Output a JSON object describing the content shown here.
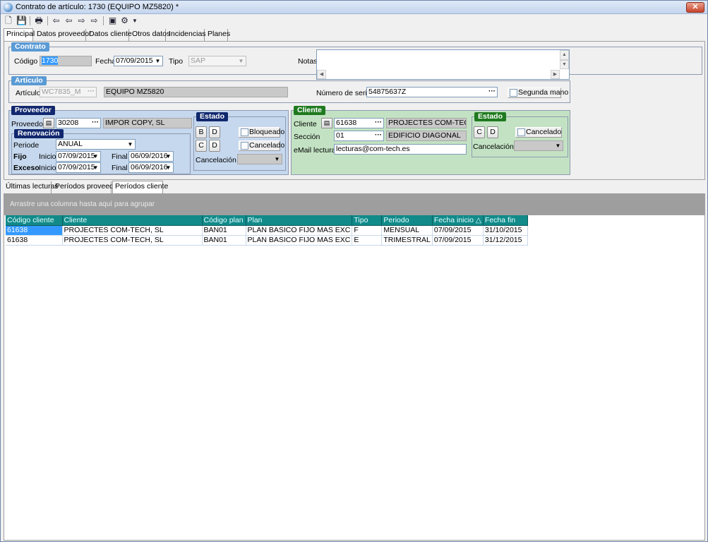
{
  "window": {
    "title": "Contrato de artículo: 1730 (EQUIPO MZ5820) *",
    "close_label": "✕"
  },
  "toolbar": {
    "icons": [
      "new-icon",
      "save-icon",
      "print-icon",
      "first-icon",
      "prev-icon",
      "next-icon",
      "last-icon",
      "export-icon",
      "tools-icon",
      "dropdown-arrow-icon"
    ]
  },
  "main_tabs": [
    "Principal",
    "Datos proveedor",
    "Datos cliente",
    "Otros datos",
    "Incidencias",
    "Planes"
  ],
  "contrato": {
    "title": "Contrato",
    "codigo_label": "Código",
    "codigo": "1730",
    "fecha_label": "Fecha",
    "fecha": "07/09/2015",
    "tipo_label": "Tipo",
    "tipo": "SAP",
    "notas_label": "Notas"
  },
  "articulo": {
    "title": "Artículo",
    "articulo_label": "Artículo",
    "articulo_code": "WC7835_M",
    "articulo_name": "EQUIPO MZ5820",
    "serie_label": "Número de serie",
    "serie": "54875637Z",
    "segunda_mano": "Segunda mano"
  },
  "proveedor": {
    "title": "Proveedor",
    "proveedor_label": "Proveedor",
    "proveedor_code": "30208",
    "proveedor_name": "IMPOR COPY, SL",
    "renovacion": {
      "title": "Renovación",
      "periodo_label": "Periode",
      "periodo": "ANUAL",
      "fijo_label": "Fijo",
      "inicio_label": "Inicio",
      "final_label": "Final",
      "fijo_inicio": "07/09/2015",
      "fijo_final": "06/09/2016",
      "exceso_label": "Exceso",
      "exceso_inicio": "07/09/2015",
      "exceso_final": "06/09/2016"
    },
    "estado": {
      "title": "Estado",
      "b": "B",
      "d": "D",
      "c": "C",
      "bloqueado": "Bloqueado",
      "cancelado": "Cancelado",
      "cancelacion_label": "Cancelación"
    }
  },
  "cliente": {
    "title": "Cliente",
    "cliente_label": "Cliente",
    "cliente_code": "61638",
    "cliente_name": "PROJECTES COM-TECH, SL",
    "seccion_label": "Sección",
    "seccion_code": "01",
    "seccion_name": "EDIFICIO DIAGONAL",
    "email_label": "eMail lecturas",
    "email": "lecturas@com-tech.es",
    "estado": {
      "title": "Estado",
      "c": "C",
      "d": "D",
      "cancelado": "Cancelado",
      "cancelacion_label": "Cancelación"
    }
  },
  "sub_tabs": [
    "Últimas lecturas",
    "Períodos proveedor",
    "Períodos cliente"
  ],
  "grid": {
    "group_hint": "Arrastre una columna hasta aquí para agrupar",
    "columns": [
      "Código cliente",
      "Cliente",
      "Código plan",
      "Plan",
      "Tipo",
      "Periodo",
      "Fecha inicio",
      "Fecha fin"
    ],
    "sort_indicator": "△",
    "rows": [
      [
        "61638",
        "PROJECTES COM-TECH, SL",
        "BAN01",
        "PLAN BASICO FIJO MAS EXC",
        "F",
        "MENSUAL",
        "07/09/2015",
        "31/10/2015"
      ],
      [
        "61638",
        "PROJECTES COM-TECH, SL",
        "BAN01",
        "PLAN BASICO FIJO MAS EXC",
        "E",
        "TRIMESTRAL",
        "07/09/2015",
        "31/12/2015"
      ]
    ]
  }
}
